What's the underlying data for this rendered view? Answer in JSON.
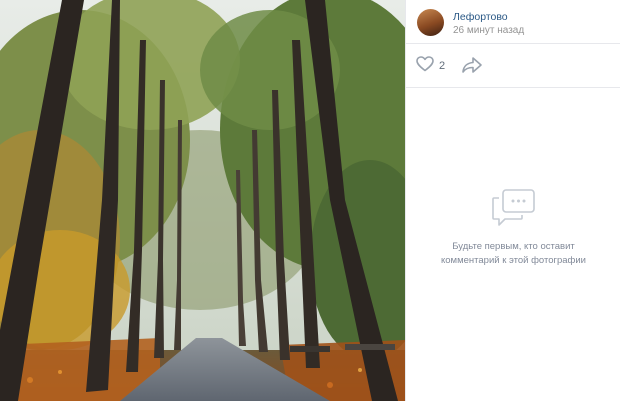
{
  "post": {
    "author_name": "Лефортово",
    "time": "26 минут назад"
  },
  "actions": {
    "likes_count": "2",
    "like_icon": "heart-icon",
    "share_icon": "share-arrow-icon"
  },
  "comments": {
    "icon": "comments-bubble-icon",
    "empty_line1": "Будьте первым, кто оставит",
    "empty_line2": "комментарий к этой фотографии"
  },
  "colors": {
    "link": "#2a5885",
    "muted": "#939393",
    "icon": "#99a2ad",
    "divider": "#e7e8ec"
  }
}
